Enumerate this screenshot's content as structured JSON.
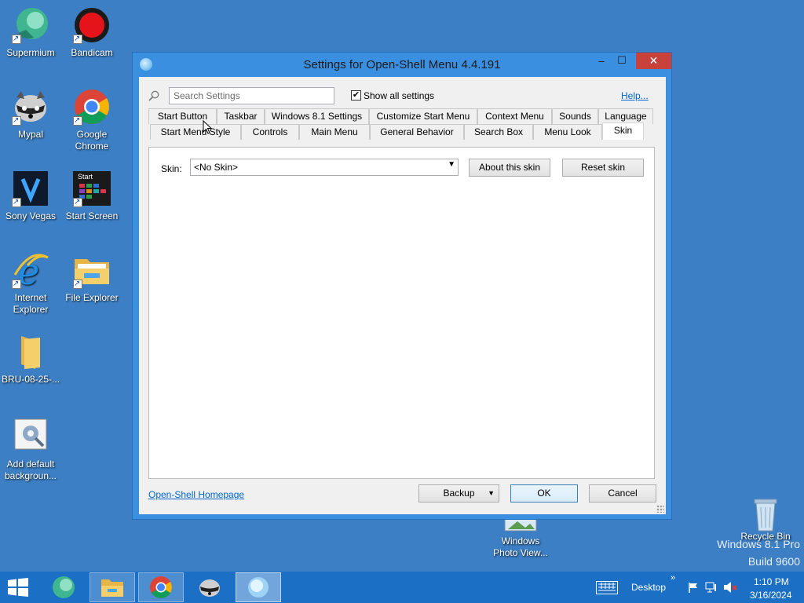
{
  "desktop": {
    "icons": [
      {
        "label": "Supermium"
      },
      {
        "label": "Bandicam"
      },
      {
        "label": "Mypal"
      },
      {
        "label": "Google Chrome"
      },
      {
        "label": "Sony Vegas"
      },
      {
        "label": "Start Screen"
      },
      {
        "label": "Internet Explorer"
      },
      {
        "label": "File Explorer"
      },
      {
        "label": "BRU-08-25-..."
      },
      {
        "label": "Add default backgroun..."
      },
      {
        "label": "Windows Photo View..."
      },
      {
        "label": "Recycle Bin"
      }
    ],
    "start_screen_tile_text": "Start",
    "watermark_line1": "Windows 8.1 Pro",
    "watermark_line2": "Build 9600"
  },
  "window": {
    "title": "Settings for Open-Shell Menu 4.4.191",
    "min_glyph": "–",
    "max_glyph": "☐",
    "close_glyph": "✕",
    "search_placeholder": "Search Settings",
    "show_all_label": "Show all settings",
    "show_all_checked": true,
    "check_glyph": "✔",
    "help_link": "Help...",
    "tabs_row1": [
      "Start Button",
      "Taskbar",
      "Windows 8.1 Settings",
      "Customize Start Menu",
      "Context Menu",
      "Sounds",
      "Language"
    ],
    "tabs_row2": [
      "Start Menu Style",
      "Controls",
      "Main Menu",
      "General Behavior",
      "Search Box",
      "Menu Look",
      "Skin"
    ],
    "active_tab": "Skin",
    "skin_label": "Skin:",
    "skin_value": "<No Skin>",
    "dropdown_arrow": "▼",
    "about_skin_button": "About this skin",
    "reset_skin_button": "Reset skin",
    "homepage_link": "Open-Shell Homepage",
    "backup_button": "Backup",
    "ok_button": "OK",
    "cancel_button": "Cancel"
  },
  "taskbar": {
    "desktop_label": "Desktop",
    "chevron": "»",
    "time": "1:10 PM",
    "date": "3/16/2024"
  },
  "colors": {
    "desktop_bg": "#3c7fc4",
    "window_frame": "#3b8fe0",
    "taskbar": "#1b6fc5",
    "close_button": "#c8413b",
    "link": "#0066cc"
  }
}
